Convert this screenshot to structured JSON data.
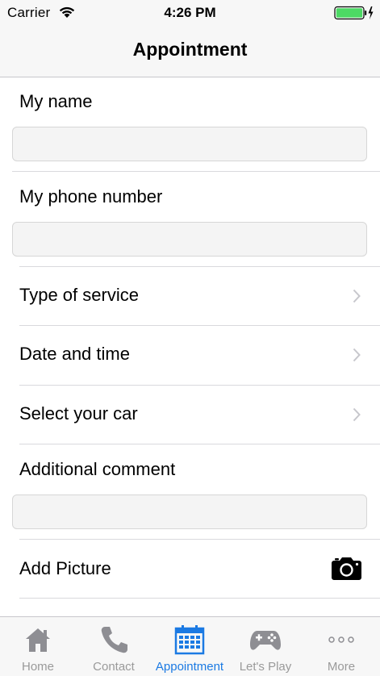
{
  "status_bar": {
    "carrier": "Carrier",
    "time": "4:26 PM",
    "battery_color": "#4cd964"
  },
  "nav": {
    "title": "Appointment"
  },
  "form": {
    "name_label": "My name",
    "name_value": "",
    "phone_label": "My phone number",
    "phone_value": "",
    "service_label": "Type of service",
    "datetime_label": "Date and time",
    "car_label": "Select your car",
    "comment_label": "Additional comment",
    "comment_value": "",
    "picture_label": "Add Picture"
  },
  "tabs": [
    {
      "label": "Home",
      "icon": "home-icon",
      "active": false
    },
    {
      "label": "Contact",
      "icon": "phone-icon",
      "active": false
    },
    {
      "label": "Appointment",
      "icon": "calendar-icon",
      "active": true
    },
    {
      "label": "Let's Play",
      "icon": "gamepad-icon",
      "active": false
    },
    {
      "label": "More",
      "icon": "more-icon",
      "active": false
    }
  ],
  "colors": {
    "accent": "#1b7ae3",
    "inactive_tab": "#9a9a9a",
    "chevron": "#c7c7cc"
  }
}
